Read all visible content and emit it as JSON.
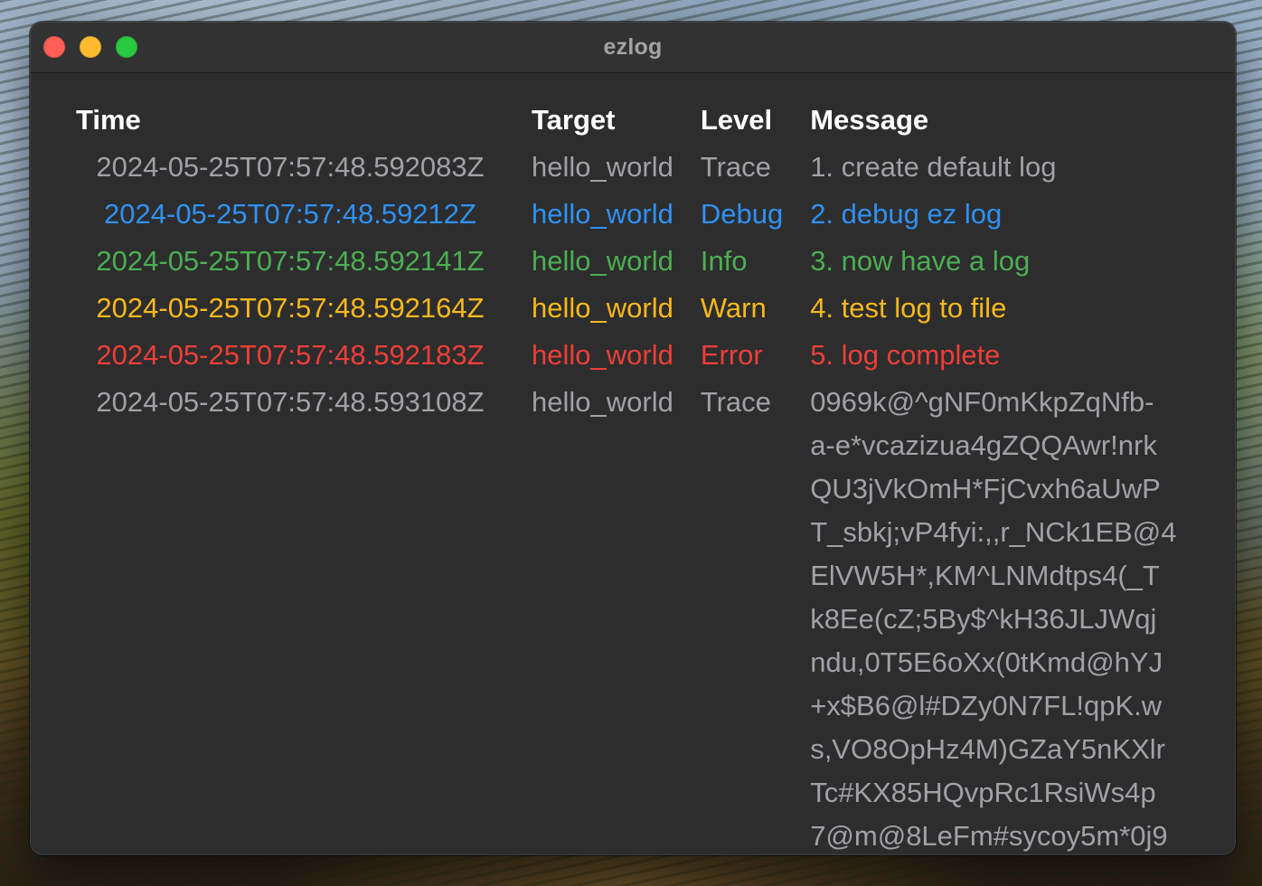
{
  "window": {
    "title": "ezlog"
  },
  "columns": {
    "time": "Time",
    "target": "Target",
    "level": "Level",
    "message": "Message"
  },
  "rows": [
    {
      "time": "2024-05-25T07:57:48.592083Z",
      "target": "hello_world",
      "level": "Trace",
      "message": "1. create default log",
      "color": "#a1a1a6"
    },
    {
      "time": "2024-05-25T07:57:48.59212Z",
      "target": "hello_world",
      "level": "Debug",
      "message": "2. debug ez log",
      "color": "#2f91f2"
    },
    {
      "time": "2024-05-25T07:57:48.592141Z",
      "target": "hello_world",
      "level": "Info",
      "message": "3. now have a log",
      "color": "#4cae52"
    },
    {
      "time": "2024-05-25T07:57:48.592164Z",
      "target": "hello_world",
      "level": "Warn",
      "message": "4. test log to file",
      "color": "#f7b81b"
    },
    {
      "time": "2024-05-25T07:57:48.592183Z",
      "target": "hello_world",
      "level": "Error",
      "message": "5. log complete",
      "color": "#ec3f38"
    },
    {
      "time": "2024-05-25T07:57:48.593108Z",
      "target": "hello_world",
      "level": "Trace",
      "message_lines": [
        "0969k@^gNF0mKkpZqNfb-",
        "a-e*vcazizua4gZQQAwr!nrk",
        "QU3jVkOmH*FjCvxh6aUwP",
        "T_sbkj;vP4fyi:,,r_NCk1EB@4",
        "ElVW5H*,KM^LNMdtps4(_T",
        "k8Ee(cZ;5By$^kH36JLJWqj",
        "ndu,0T5E6oXx(0tKmd@hYJ",
        "+x$B6@l#DZy0N7FL!qpK.w",
        "s,VO8OpHz4M)GZaY5nKXlr",
        "Tc#KX85HQvpRc1RsiWs4p",
        "7@m@8LeFm#sycoy5m*0j9"
      ],
      "color": "#a1a1a6"
    }
  ]
}
